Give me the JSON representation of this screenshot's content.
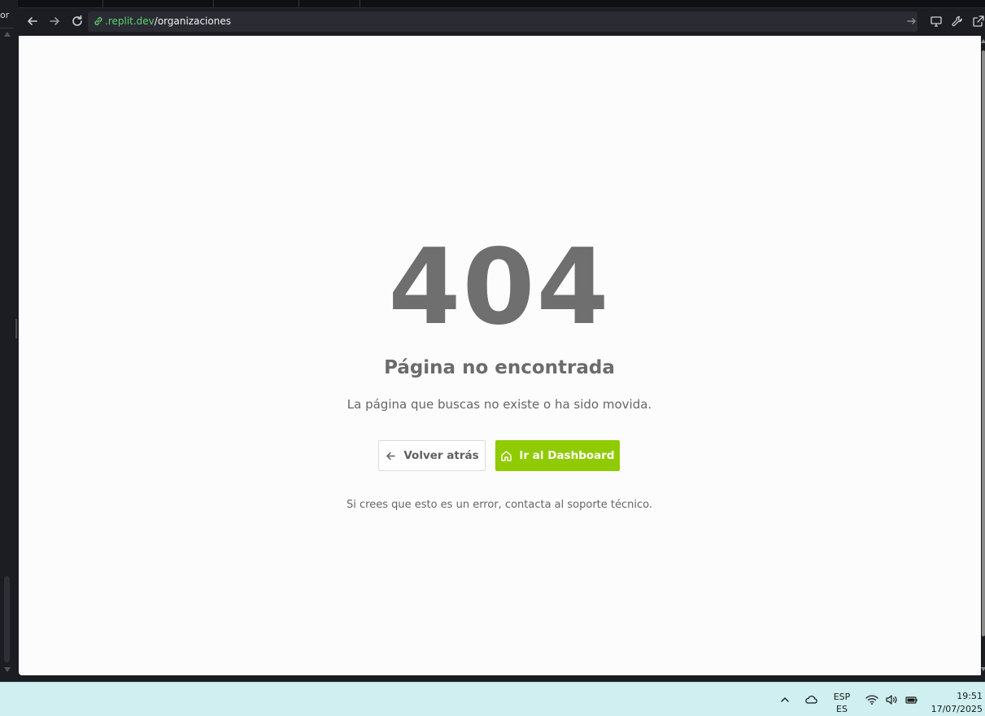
{
  "editor": {
    "tab_label": "or"
  },
  "browser": {
    "url_domain": ".replit.dev",
    "url_path": "/organizaciones"
  },
  "page": {
    "code": "404",
    "title": "Página no encontrada",
    "description": "La página que buscas no existe o ha sido movida.",
    "back_button": "Volver atrás",
    "dashboard_button": "Ir al Dashboard",
    "support_text": "Si crees que esto es un error, contacta al soporte técnico.",
    "accent_color": "#8fcb00"
  },
  "taskbar": {
    "lang_line1": "ESP",
    "lang_line2": "ES",
    "time": "19:51",
    "date": "17/07/2025",
    "icons": [
      "chevron-up-icon",
      "cloud-icon",
      "wifi-icon",
      "speaker-icon",
      "battery-icon"
    ]
  }
}
